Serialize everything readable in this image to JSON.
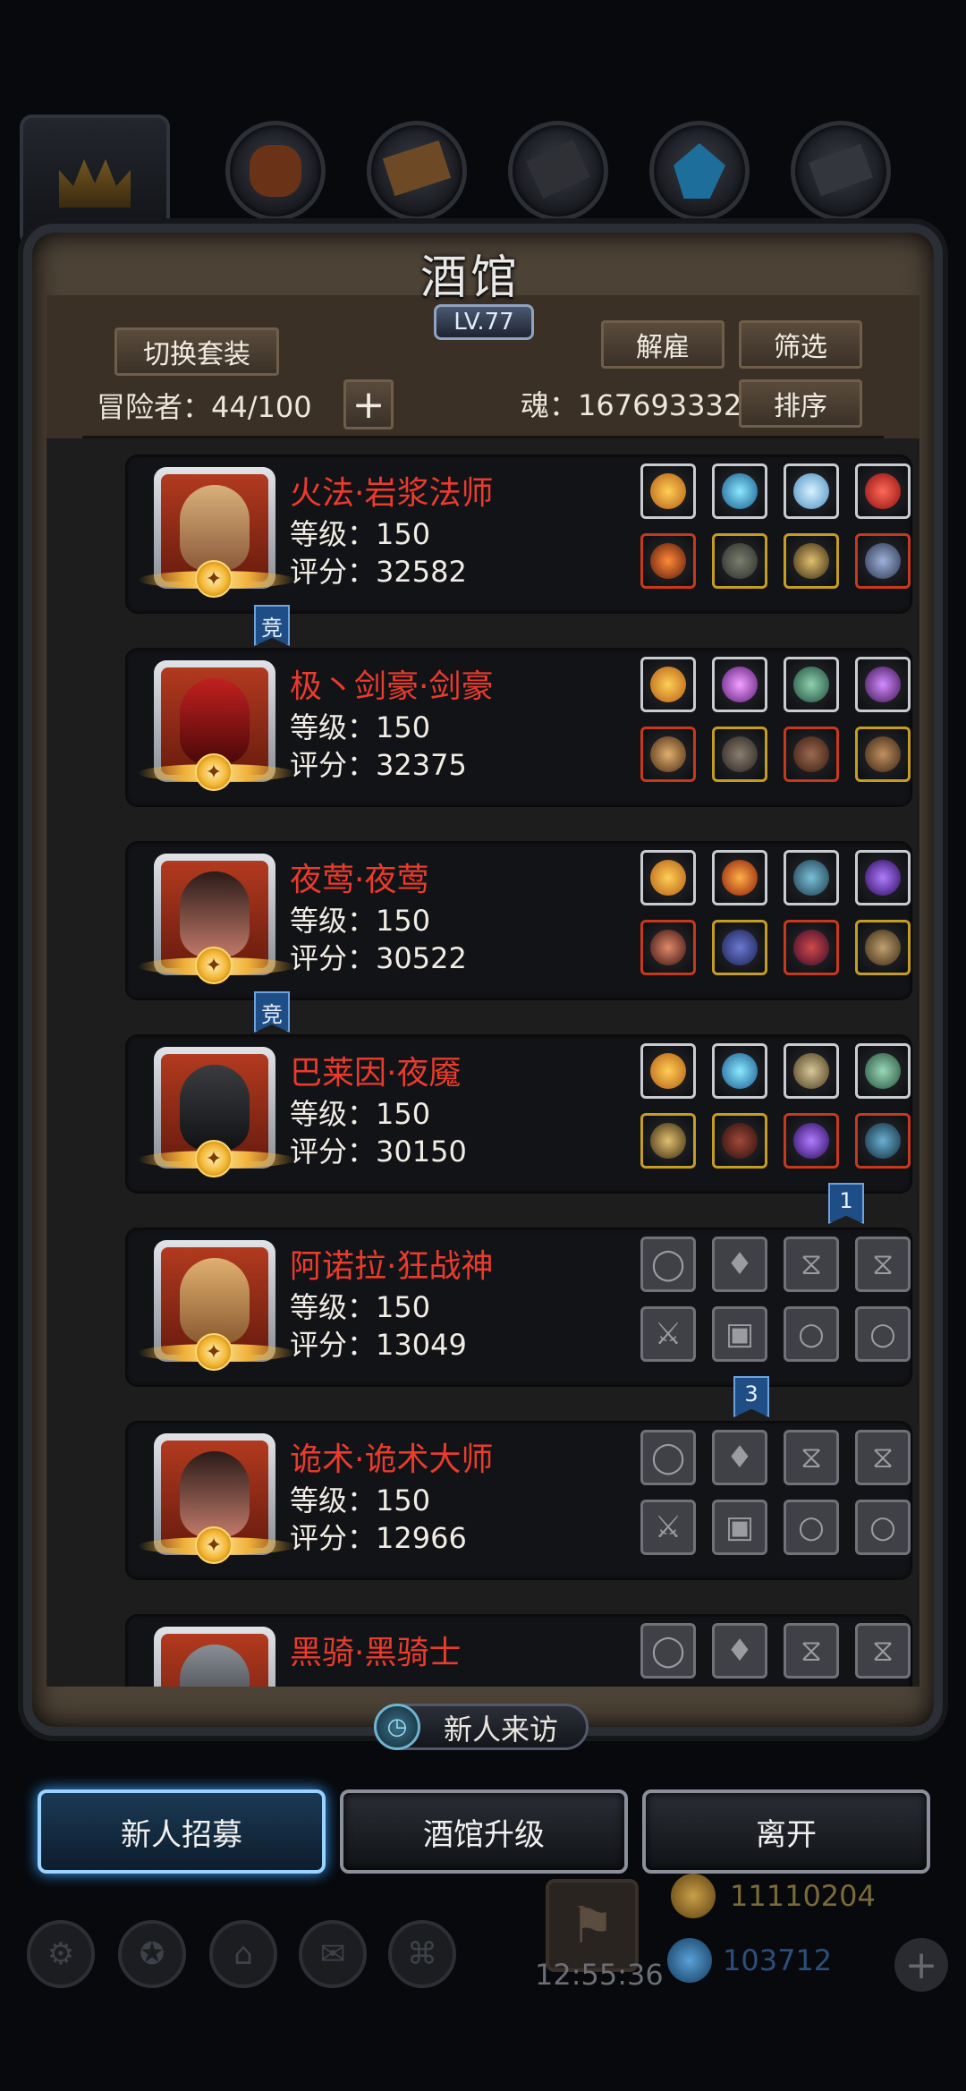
{
  "header": {
    "title": "酒馆",
    "level": "LV.77"
  },
  "toolbar": {
    "switch_set": "切换套装",
    "dismiss": "解雇",
    "filter": "筛选",
    "sort": "排序",
    "add": "+"
  },
  "stats": {
    "adventurers": "冒险者：44/100",
    "soul": "魂：167693332"
  },
  "heroes": [
    {
      "name": "火法·岩浆法师",
      "level": "等级：150",
      "score": "评分：32582"
    },
    {
      "name": "极丶剑豪·剑豪",
      "level": "等级：150",
      "score": "评分：32375"
    },
    {
      "name": "夜莺·夜莺",
      "level": "等级：150",
      "score": "评分：30522"
    },
    {
      "name": "巴莱因·夜魇",
      "level": "等级：150",
      "score": "评分：30150"
    },
    {
      "name": "阿诺拉·狂战神",
      "level": "等级：150",
      "score": "评分：13049"
    },
    {
      "name": "诡术·诡术大师",
      "level": "等级：150",
      "score": "评分：12966"
    },
    {
      "name": "黑骑·黑骑士",
      "level": "",
      "score": ""
    }
  ],
  "tags": {
    "compete_1": "竞",
    "compete_2": "竞",
    "rank_1": "1",
    "rank_3": "3"
  },
  "visit": {
    "label": "新人来访"
  },
  "actions": {
    "recruit": "新人招募",
    "upgrade": "酒馆升级",
    "leave": "离开"
  },
  "background": {
    "timer": "12:55:36",
    "gold": "11110204",
    "gems": "103712"
  },
  "colors": {
    "name_red": "#ea3b2d",
    "frame_brown": "#4c4236",
    "primary_glow": "#3aa0ff"
  }
}
